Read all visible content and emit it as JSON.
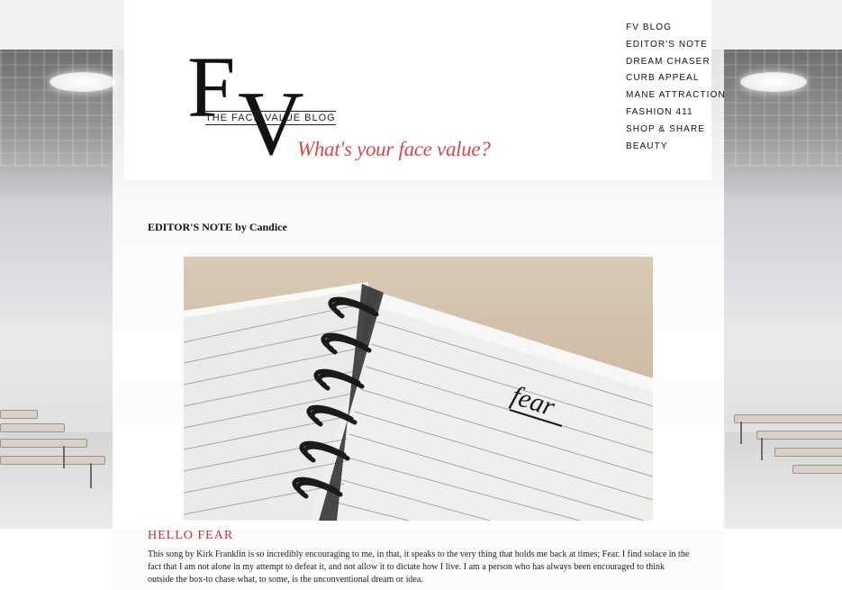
{
  "site": {
    "logo_letters_f": "F",
    "logo_letters_v": "V",
    "logo_name": "THE FACE VALUE BLOG",
    "tagline": "What's your face value?",
    "accent_color": "#d24a4f"
  },
  "nav": {
    "items": [
      {
        "label": "FV BLOG"
      },
      {
        "label": "EDITOR'S NOTE"
      },
      {
        "label": "DREAM CHASER"
      },
      {
        "label": "CURB APPEAL"
      },
      {
        "label": "MANE ATTRACTION"
      },
      {
        "label": "FASHION 411"
      },
      {
        "label": "SHOP & SHARE"
      },
      {
        "label": "BEAUTY"
      }
    ]
  },
  "page": {
    "section_title": "EDITOR'S NOTE by Candice",
    "image_handwriting": "fear"
  },
  "post": {
    "title": "HELLO FEAR",
    "body": "This song by Kirk Franklin is so incredibly encouraging to me, in that, it speaks to the very thing that holds me back at times; Fear. I find solace in the fact that I am not alone in my attempt to defeat it, and not allow it to dictate how I live. I am a person who has always been encouraged to think outside the box-to chase what, to some, is the unconventional dream or idea."
  }
}
